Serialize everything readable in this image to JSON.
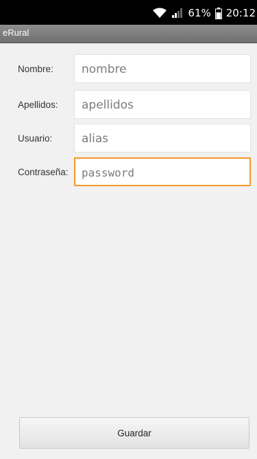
{
  "status_bar": {
    "battery": "61%",
    "time": "20:12",
    "icons": [
      "wifi-icon",
      "signal-icon",
      "battery-icon"
    ]
  },
  "app": {
    "title": "eRural"
  },
  "form": {
    "fields": [
      {
        "label": "Nombre:",
        "placeholder": "nombre",
        "value": ""
      },
      {
        "label": "Apellidos:",
        "placeholder": "apellidos",
        "value": ""
      },
      {
        "label": "Usuario:",
        "placeholder": "alias",
        "value": ""
      },
      {
        "label": "Contraseña:",
        "placeholder": "password",
        "value": "",
        "focused": true
      }
    ],
    "save_label": "Guardar"
  },
  "colors": {
    "focus_border": "#f39a29",
    "status_bar": "#000000",
    "title_bar": "#7f7f7f"
  }
}
